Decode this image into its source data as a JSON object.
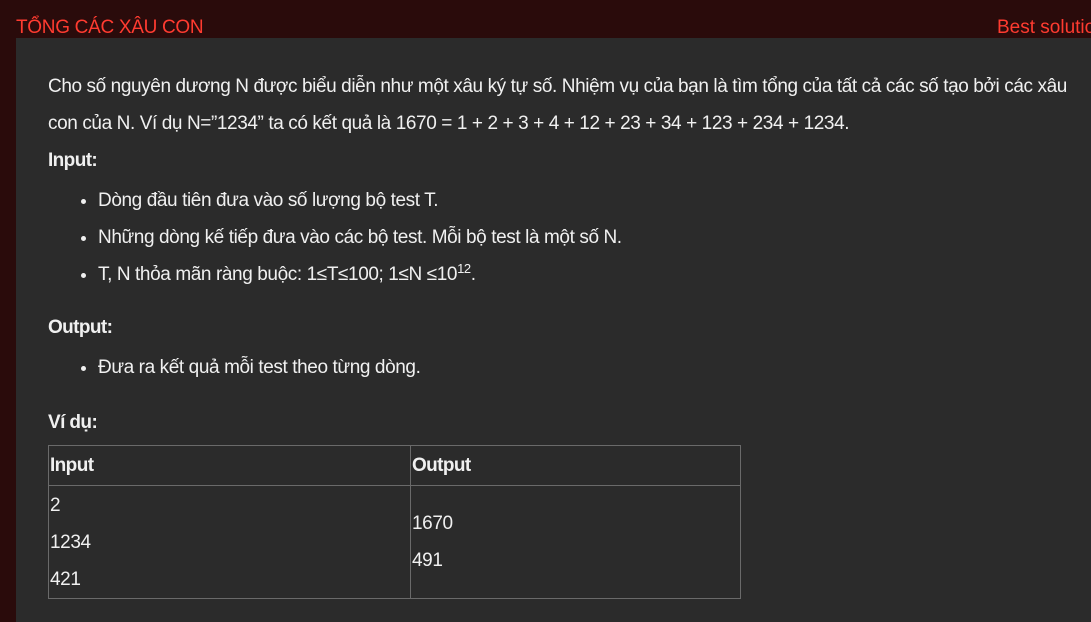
{
  "header": {
    "title": "TỔNG CÁC XÂU CON",
    "right_link": "Best solutio"
  },
  "problem": {
    "intro_line1": "Cho số nguyên dương N được biểu diễn như một xâu ký tự số. Nhiệm vụ của bạn là tìm tổng của tất cả các số tạo bởi các xâu",
    "intro_line2": "con của N. Ví dụ N=”1234” ta có kết quả là 1670 = 1 + 2 + 3 + 4 + 12 + 23 + 34 + 123 + 234 + 1234.",
    "input_heading": "Input:",
    "input_items": [
      "Dòng đầu tiên đưa vào số lượng bộ test T.",
      "Những dòng kế tiếp đưa vào các bộ test. Mỗi bộ test là một số N."
    ],
    "constraint_text": "T, N thỏa mãn ràng buộc: 1≤T≤100;  1≤N ≤10",
    "constraint_exp": "12",
    "constraint_end": ".",
    "output_heading": "Output:",
    "output_items": [
      "Đưa ra kết quả mỗi test theo từng dòng."
    ],
    "example_heading": "Ví dụ:",
    "table": {
      "headers": [
        "Input",
        "Output"
      ],
      "input_lines": [
        "2",
        "1234",
        "421"
      ],
      "output_lines": [
        "1670",
        "491"
      ]
    }
  },
  "colors": {
    "accent": "#ff3b30",
    "background": "#2a0b0b",
    "panel": "#2b2b2b",
    "text": "#f0f0f0"
  }
}
